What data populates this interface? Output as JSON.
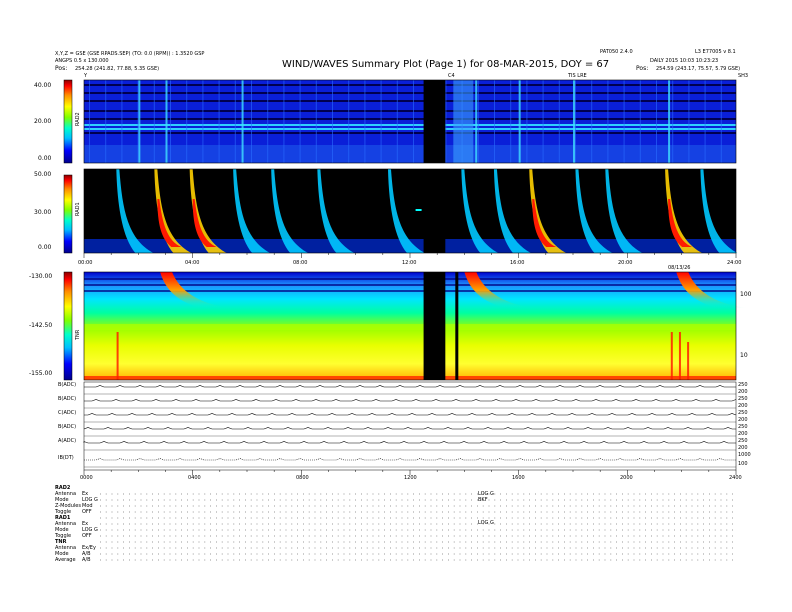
{
  "header": {
    "left_line1": "X,Y,Z = GSE (GSE RPADS.SEP) (TO: 0.0 (RPM)) : 1.3520 GSP",
    "left_line2": "ANGPS 0.5 x 130.000",
    "left_line3_label": "Pos:",
    "left_line3_value": "254.28 (241.82, 77.88, 5.35 GSE)",
    "title": "WIND/WAVES Summary Plot (Page 1) for 08-MAR-2015, DOY = 67",
    "right_top_a": "PAT050 2.4.0",
    "right_top_b": "L3 E77005 v 8.1",
    "right_line2": "DAILY 2015 10:03 10:23:23",
    "right_line3_label": "Pos:",
    "right_line3_value": "254.59 (243.17, 75.57, 5.79 GSE)",
    "left_corner": "Y",
    "right_corner": "SH3",
    "center_marker": "C4",
    "right_marker": "TIS LRE"
  },
  "panels": {
    "rad2": {
      "label": "RAD2",
      "ticks": [
        "40.00",
        "20.00",
        "0.00"
      ]
    },
    "rad1": {
      "label": "RAD1",
      "ticks": [
        "50.00",
        "30.00",
        "0.00"
      ]
    },
    "tnr": {
      "label": "TNR",
      "ticks": [
        "-130.00",
        "-142.50",
        "-155.00"
      ],
      "right_ticks": [
        "100",
        "10"
      ]
    },
    "mid_axis_labels": [
      "00:00",
      "04:00",
      "08:00",
      "12:00",
      "16:00",
      "20:00",
      "24:00"
    ],
    "mid_axis_extra": "08/13/26",
    "line_labels": [
      "B(ADC)",
      "B(ADC)",
      "C(ADC)",
      "B(ADC)",
      "A(ADC)",
      "IB(DT)"
    ],
    "line_right_ticks": [
      "250",
      "200",
      "250",
      "200",
      "250",
      "200",
      "250",
      "200",
      "250",
      "200",
      "1000",
      "100"
    ],
    "bottom_axis_labels": [
      "0000",
      "0400",
      "0800",
      "1200",
      "1600",
      "2000",
      "2400"
    ]
  },
  "footer": {
    "rad2_head": "RAD2",
    "rad2_rows": [
      [
        "Antenna",
        "Ex"
      ],
      [
        "Mode",
        "LOG G"
      ],
      [
        "Z-Modules",
        "Mod"
      ],
      [
        "Toggle",
        "OFF"
      ]
    ],
    "rad1_head": "RAD1",
    "rad1_rows": [
      [
        "Antenna",
        "Ex"
      ],
      [
        "Mode",
        "LOG G"
      ],
      [
        "Toggle",
        "OFF"
      ]
    ],
    "tnr_head": "TNR",
    "tnr_rows": [
      [
        "Antenna",
        "Ex/Ey"
      ],
      [
        "Mode",
        "A/B"
      ],
      [
        "Average",
        "A/B"
      ]
    ],
    "mid_marks": [
      "LOG G",
      "BKF",
      "LOG G"
    ]
  },
  "chart_data": {
    "type": "heatmap",
    "title": "WIND/WAVES Summary Plot (Page 1) for 08-MAR-2015, DOY = 67",
    "x_range_hours": [
      0,
      24
    ],
    "panels": [
      {
        "name": "RAD2",
        "y_range": [
          0,
          40
        ],
        "burst_hours": [
          2.0,
          3.0,
          5.8,
          12.6,
          14.4,
          16.0,
          18.0,
          21.5
        ]
      },
      {
        "name": "RAD1",
        "y_range": [
          0,
          50
        ],
        "burst_hours": [
          1.3,
          2.7,
          4.0,
          5.6,
          7.0,
          8.7,
          11.3,
          14.0,
          15.2,
          16.5,
          18.2,
          19.3,
          21.5,
          22.8
        ]
      },
      {
        "name": "TNR",
        "y_range": [
          -155,
          -130
        ],
        "burst_hours": [
          2.8,
          14.0,
          21.8
        ]
      }
    ],
    "data_gap_hours": [
      12.5,
      13.3
    ],
    "colorscale": [
      "#00008b",
      "#0000ff",
      "#00bfff",
      "#00ffcc",
      "#7fff00",
      "#ffff00",
      "#ff8c00",
      "#ff0000",
      "#8b0000"
    ],
    "grid": false
  }
}
